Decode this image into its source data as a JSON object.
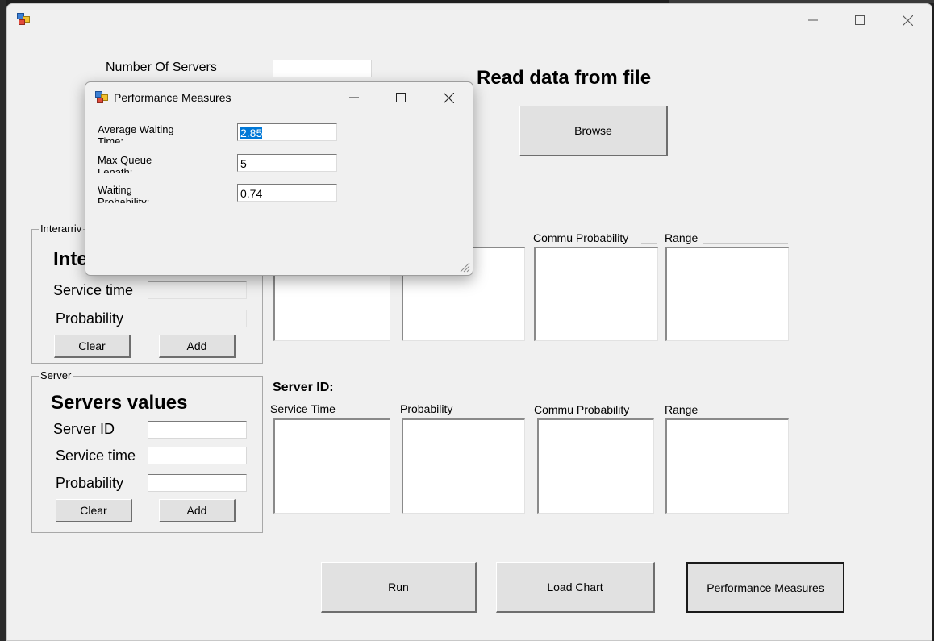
{
  "main_window": {
    "title": "",
    "number_of_servers_label": "Number Of Servers",
    "number_of_servers_value": "",
    "read_data_heading": "Read data from file",
    "browse_label": "Browse",
    "interarrival": {
      "group_title": "Interarriv",
      "heading": "Inte",
      "service_time_label": "Service time",
      "service_time_value": "",
      "probability_label": "Probability",
      "probability_value": "",
      "clear_label": "Clear",
      "add_label": "Add"
    },
    "interarrival_table": {
      "headers": [
        "Commu Probability",
        "Range"
      ]
    },
    "server": {
      "group_title": "Server",
      "heading": "Servers values",
      "server_id_label": "Server ID",
      "server_id_value": "",
      "service_time_label": "Service time",
      "service_time_value": "",
      "probability_label": "Probability",
      "probability_value": "",
      "clear_label": "Clear",
      "add_label": "Add"
    },
    "server_table": {
      "server_id_label": "Server ID:",
      "headers": [
        "Service Time",
        "Probability",
        "Commu Probability",
        "Range"
      ]
    },
    "bottom_buttons": {
      "run": "Run",
      "load_chart": "Load Chart",
      "performance_measures": "Performance Measures"
    }
  },
  "dialog": {
    "title": "Performance Measures",
    "fields": [
      {
        "label_line1": "Average Waiting",
        "label_line2": "Time:",
        "value": "2.85",
        "selected": true
      },
      {
        "label_line1": "Max Queue",
        "label_line2": "Lenath:",
        "value": "5",
        "selected": false
      },
      {
        "label_line1": "Waiting",
        "label_line2": "Probabilitv:",
        "value": "0.74",
        "selected": false
      }
    ]
  },
  "colors": {
    "selection": "#0078d7",
    "window_bg": "#f0f0f0",
    "desktop_bg": "#1f1f1f"
  }
}
